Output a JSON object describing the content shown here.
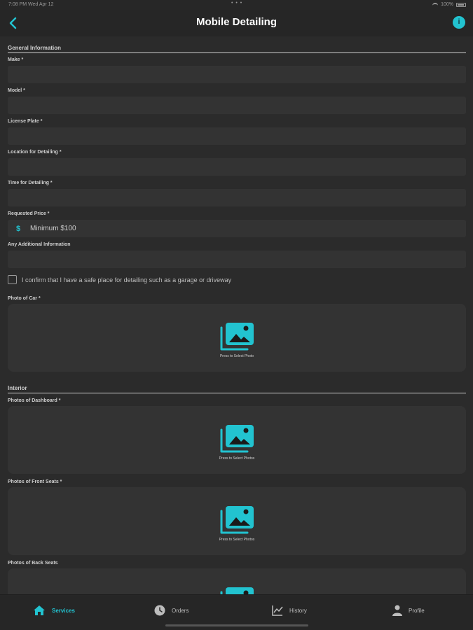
{
  "status_bar": {
    "time": "7:08 PM  Wed Apr 12",
    "dots": "• • •",
    "battery_label": "100%"
  },
  "nav": {
    "title": "Mobile Detailing",
    "info_label": "i"
  },
  "form": {
    "general_header": "General Information",
    "make_label": "Make *",
    "model_label": "Model *",
    "license_label": "License Plate *",
    "location_label": "Location for Detailing *",
    "time_label": "Time for Detailing *",
    "price_label": "Requested Price *",
    "price_currency": "$",
    "price_placeholder": "Minimum $100",
    "additional_label": "Any Additional Information",
    "confirm_text": "I confirm that I have a safe place for detailing such as a garage or driveway",
    "photo_car_label": "Photo of Car *",
    "photo_car_caption": "Press to Select Photo",
    "interior_header": "Interior",
    "dashboard_label": "Photos of Dashboard *",
    "dashboard_caption": "Press to Select Photos",
    "front_seats_label": "Photos of Front Seats *",
    "front_seats_caption": "Press to Select Photos",
    "back_seats_label": "Photos of Back Seats"
  },
  "tabs": [
    {
      "label": "Services",
      "icon": "home-icon",
      "active": true
    },
    {
      "label": "Orders",
      "icon": "clock-icon",
      "active": false
    },
    {
      "label": "History",
      "icon": "chart-icon",
      "active": false
    },
    {
      "label": "Profile",
      "icon": "person-icon",
      "active": false
    }
  ],
  "colors": {
    "accent": "#22c3d0",
    "background": "#2b2b2b",
    "field": "#333333"
  }
}
